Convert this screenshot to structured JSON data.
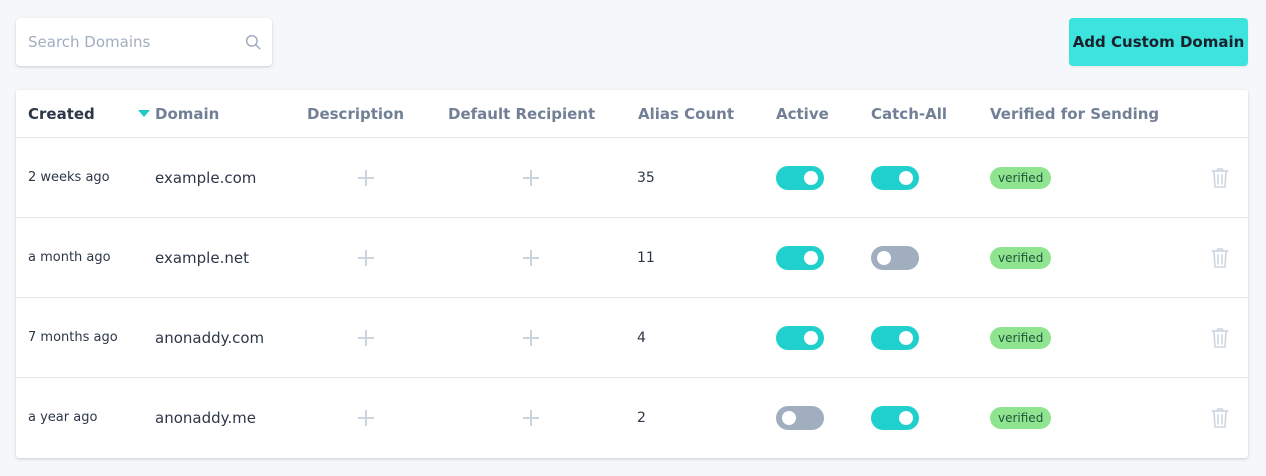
{
  "search": {
    "placeholder": "Search Domains",
    "value": "",
    "icon": "search-icon"
  },
  "add_button": {
    "label": "Add Custom Domain"
  },
  "colors": {
    "accent": "#3de3dd",
    "toggle_on": "#20d0cc",
    "toggle_off": "#a0aec0",
    "badge_bg": "#8ee48f",
    "sort_arrow": "#20c9c6"
  },
  "table": {
    "columns": {
      "created": "Created",
      "domain": "Domain",
      "description": "Description",
      "default_recipient": "Default Recipient",
      "alias_count": "Alias Count",
      "active": "Active",
      "catch_all": "Catch-All",
      "verified": "Verified for Sending"
    },
    "sorted_by": "created",
    "sort_direction": "descending",
    "rows": [
      {
        "created": "2 weeks ago",
        "domain": "example.com",
        "alias_count": "35",
        "active": true,
        "catch_all": true,
        "verified": "verified"
      },
      {
        "created": "a month ago",
        "domain": "example.net",
        "alias_count": "11",
        "active": true,
        "catch_all": false,
        "verified": "verified"
      },
      {
        "created": "7 months ago",
        "domain": "anonaddy.com",
        "alias_count": "4",
        "active": true,
        "catch_all": true,
        "verified": "verified"
      },
      {
        "created": "a year ago",
        "domain": "anonaddy.me",
        "alias_count": "2",
        "active": false,
        "catch_all": true,
        "verified": "verified"
      }
    ]
  }
}
